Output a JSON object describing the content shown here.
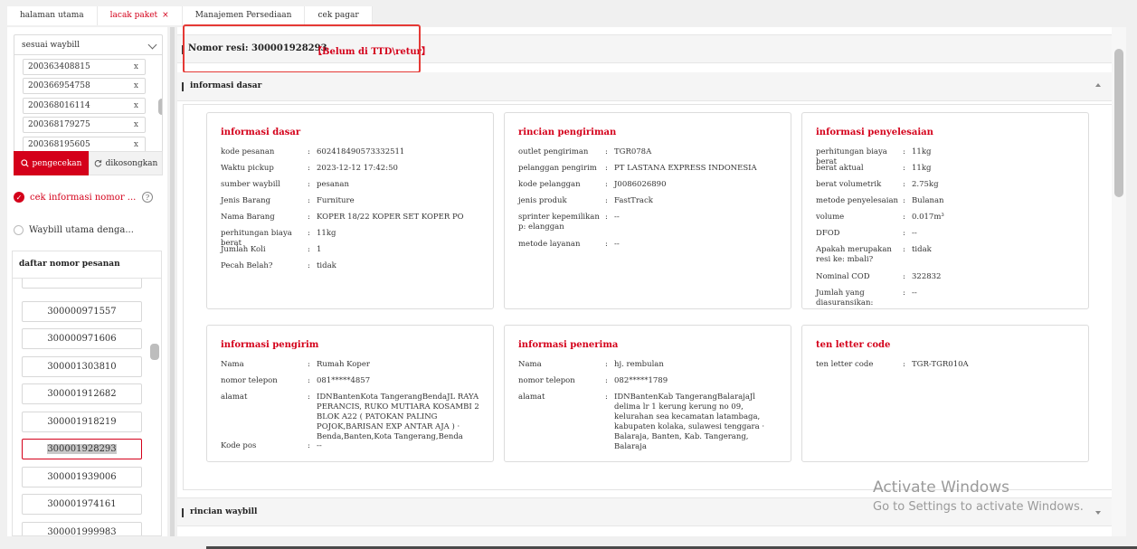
{
  "tabs": [
    {
      "label": "halaman utama"
    },
    {
      "label": "lacak paket",
      "close": "×"
    },
    {
      "label": "Manajemen Persediaan"
    },
    {
      "label": "cek pagar"
    }
  ],
  "left": {
    "select_value": "sesuai waybill",
    "waybills": [
      "200363408815",
      "200366954758",
      "200368016114",
      "200368179275",
      "200368195605"
    ],
    "chip_remove": "x",
    "check_button": "pengecekan",
    "clear_button": "dikosongkan",
    "option1": "cek informasi nomor ...",
    "option2": "Waybill utama denga...",
    "help": "?",
    "list_title": "daftar nomor pesanan",
    "orders": [
      "300000971557",
      "300000971606",
      "300001303810",
      "300001912682",
      "300001918219",
      "300001928293",
      "300001939006",
      "300001974161",
      "300001999983"
    ]
  },
  "resi": {
    "label": "Nomor resi:",
    "number": "300001928293",
    "status": "【Belum di TTD\\retur】"
  },
  "sections": {
    "basic": "informasi dasar",
    "waybill": "rincian waybill"
  },
  "cards": {
    "dasar": {
      "title": "informasi dasar",
      "rows": [
        {
          "k": "kode pesanan",
          "v": "602418490573332511"
        },
        {
          "k": "Waktu pickup",
          "v": "2023-12-12 17:42:50"
        },
        {
          "k": "sumber waybill",
          "v": "pesanan"
        },
        {
          "k": "Jenis Barang",
          "v": "Furniture"
        },
        {
          "k": "Nama Barang",
          "v": "KOPER 18/22 KOPER SET KOPER PO"
        },
        {
          "k": "perhitungan biaya berat",
          "v": "11kg"
        },
        {
          "k": "Jumlah Koli",
          "v": "1"
        },
        {
          "k": "Pecah Belah?",
          "v": "tidak"
        }
      ]
    },
    "pengiriman": {
      "title": "rincian pengiriman",
      "rows": [
        {
          "k": "outlet pengiriman",
          "v": "TGR078A"
        },
        {
          "k": "pelanggan pengirim",
          "v": "PT LASTANA EXPRESS INDONESIA"
        },
        {
          "k": "kode pelanggan",
          "v": "J0086026890"
        },
        {
          "k": "jenis produk",
          "v": "FastTrack"
        },
        {
          "k": "sprinter kepemilikan p: elanggan",
          "v": "--"
        },
        {
          "k": "metode layanan",
          "v": "--"
        }
      ]
    },
    "penyelesaian": {
      "title": "informasi penyelesaian",
      "rows": [
        {
          "k": "perhitungan biaya berat",
          "v": "11kg"
        },
        {
          "k": "berat aktual",
          "v": "11kg"
        },
        {
          "k": "berat volumetrik",
          "v": "2.75kg"
        },
        {
          "k": "metode penyelesaian",
          "v": "Bulanan"
        },
        {
          "k": "volume",
          "v": "0.017m³"
        },
        {
          "k": "DFOD",
          "v": "--"
        },
        {
          "k": "Apakah merupakan resi ke: mbali?",
          "v": "tidak"
        },
        {
          "k": "Nominal COD",
          "v": "322832"
        },
        {
          "k": "Jumlah yang diasuransikan:",
          "v": "--"
        }
      ]
    },
    "pengirim": {
      "title": "informasi pengirim",
      "rows": [
        {
          "k": "Nama",
          "v": "Rumah Koper"
        },
        {
          "k": "nomor telepon",
          "v": "081*****4857"
        },
        {
          "k": "alamat",
          "v": "IDNBantenKota TangerangBendaJL RAYA PERANCIS, RUKO MUTIARA KOSAMBI 2 BLOK A22 ( PATOKAN PALING POJOK,BARISAN EXP ANTAR AJA ) · Benda,Banten,Kota Tangerang,Benda"
        },
        {
          "k": "Kode pos",
          "v": "--"
        }
      ]
    },
    "penerima": {
      "title": "informasi penerima",
      "rows": [
        {
          "k": "Nama",
          "v": "hj. rembulan"
        },
        {
          "k": "nomor telepon",
          "v": "082*****1789"
        },
        {
          "k": "alamat",
          "v": "IDNBantenKab TangerangBalarajaJl delima lr 1 kerung kerung no 09, kelurahan sea kecamatan latambaga, kabupaten kolaka, sulawesi tenggara · Balaraja, Banten, Kab. Tangerang, Balaraja"
        }
      ]
    },
    "tenletter": {
      "title": "ten letter code",
      "rows": [
        {
          "k": "ten letter code",
          "v": "TGR-TGR010A"
        }
      ]
    }
  },
  "watermark": {
    "line1": "Activate Windows",
    "line2": "Go to Settings to activate Windows."
  },
  "colors": {
    "accent": "#d4001a",
    "highlight_box": "#e53935"
  }
}
